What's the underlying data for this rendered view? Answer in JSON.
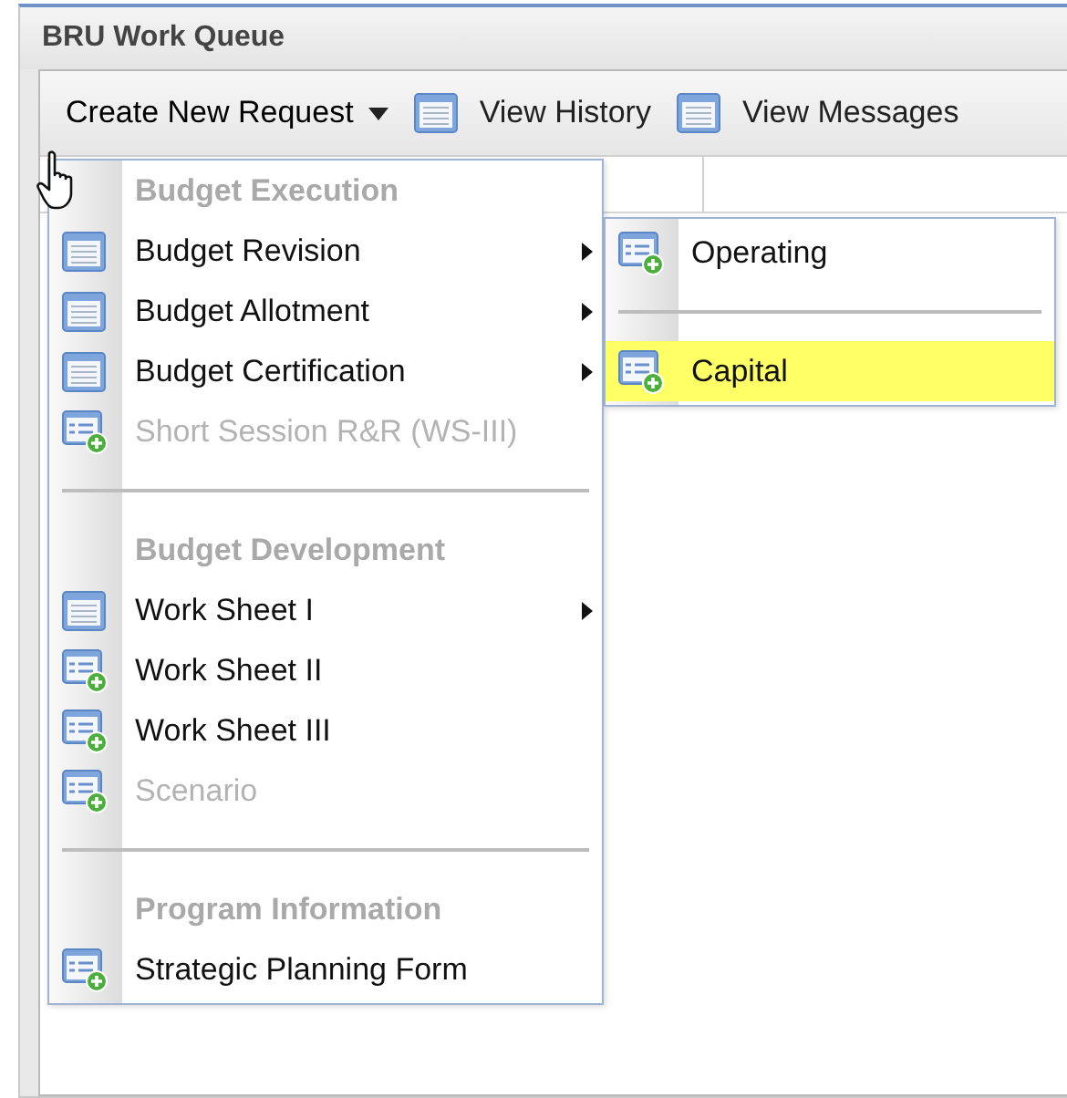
{
  "window": {
    "title": "BRU Work Queue"
  },
  "toolbar": [
    {
      "label": "Create New Request",
      "kind": "dropdown",
      "expanded": true
    },
    {
      "label": "View History",
      "kind": "button"
    },
    {
      "label": "View Messages",
      "kind": "button"
    }
  ],
  "menu": [
    {
      "kind": "header",
      "label": "Budget Execution"
    },
    {
      "kind": "submenu",
      "label": "Budget Revision",
      "disabled": false
    },
    {
      "kind": "submenu",
      "label": "Budget Allotment",
      "disabled": false
    },
    {
      "kind": "submenu",
      "label": "Budget Certification",
      "disabled": false
    },
    {
      "kind": "action",
      "label": "Short Session R&R (WS-III)",
      "disabled": true
    },
    {
      "kind": "separator"
    },
    {
      "kind": "header",
      "label": "Budget Development"
    },
    {
      "kind": "submenu",
      "label": "Work Sheet I",
      "disabled": false
    },
    {
      "kind": "action",
      "label": "Work Sheet II",
      "disabled": false
    },
    {
      "kind": "action",
      "label": "Work Sheet III",
      "disabled": false
    },
    {
      "kind": "action",
      "label": "Scenario",
      "disabled": true
    },
    {
      "kind": "separator"
    },
    {
      "kind": "header",
      "label": "Program Information"
    },
    {
      "kind": "action",
      "label": "Strategic Planning Form",
      "disabled": false
    }
  ],
  "submenu": [
    {
      "kind": "action",
      "label": "Operating",
      "selected": false
    },
    {
      "kind": "separator"
    },
    {
      "kind": "action",
      "label": "Capital",
      "selected": true
    }
  ]
}
